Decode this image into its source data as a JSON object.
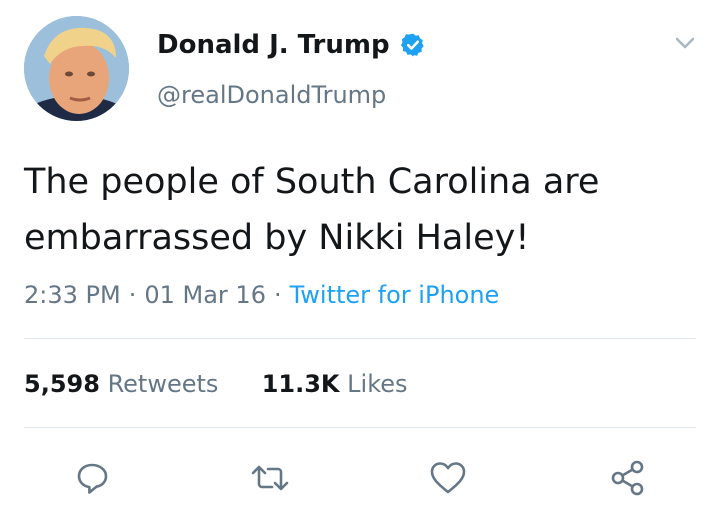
{
  "user": {
    "display_name": "Donald J. Trump",
    "handle": "@realDonaldTrump",
    "verified": true
  },
  "tweet": {
    "text": "The people of South Carolina are embarrassed by Nikki Haley!",
    "time": "2:33 PM",
    "date": "01 Mar 16",
    "separator": "·",
    "source": "Twitter for iPhone"
  },
  "stats": {
    "retweets_count": "5,598",
    "retweets_label": "Retweets",
    "likes_count": "11.3K",
    "likes_label": "Likes"
  },
  "icons": {
    "menu": "chevron-down-icon",
    "reply": "reply-icon",
    "retweet": "retweet-icon",
    "like": "heart-icon",
    "share": "share-icon",
    "verified": "verified-badge-icon"
  },
  "colors": {
    "text": "#14171a",
    "secondary": "#657786",
    "link": "#1da1f2",
    "verified": "#1da1f2",
    "divider": "#e1e8ed"
  }
}
